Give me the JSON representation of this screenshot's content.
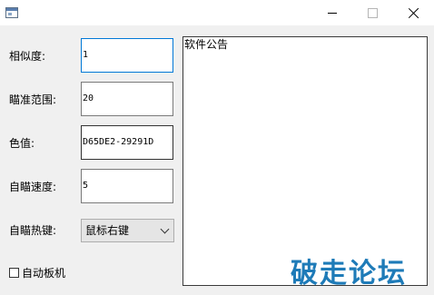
{
  "window": {
    "title": "",
    "icon": "app-window-icon",
    "controls": [
      "minimize-icon",
      "maximize-icon",
      "close-icon"
    ]
  },
  "form": {
    "similarity_label": "相似度:",
    "similarity_value": "1",
    "aim_range_label": "瞄准范围:",
    "aim_range_value": "20",
    "color_label": "色值:",
    "color_value": "D65DE2-29291D",
    "aim_speed_label": "自瞄速度:",
    "aim_speed_value": "5",
    "hotkey_label": "自瞄热键:",
    "hotkey_value": "鼠标右键",
    "auto_trigger_label": "自动板机"
  },
  "notice": {
    "title": "软件公告"
  },
  "watermark": {
    "text": "破走论坛",
    "color": "#1e7bb8"
  },
  "colors": {
    "focus_border": "#0078d7",
    "background": "#f0f0f0"
  }
}
